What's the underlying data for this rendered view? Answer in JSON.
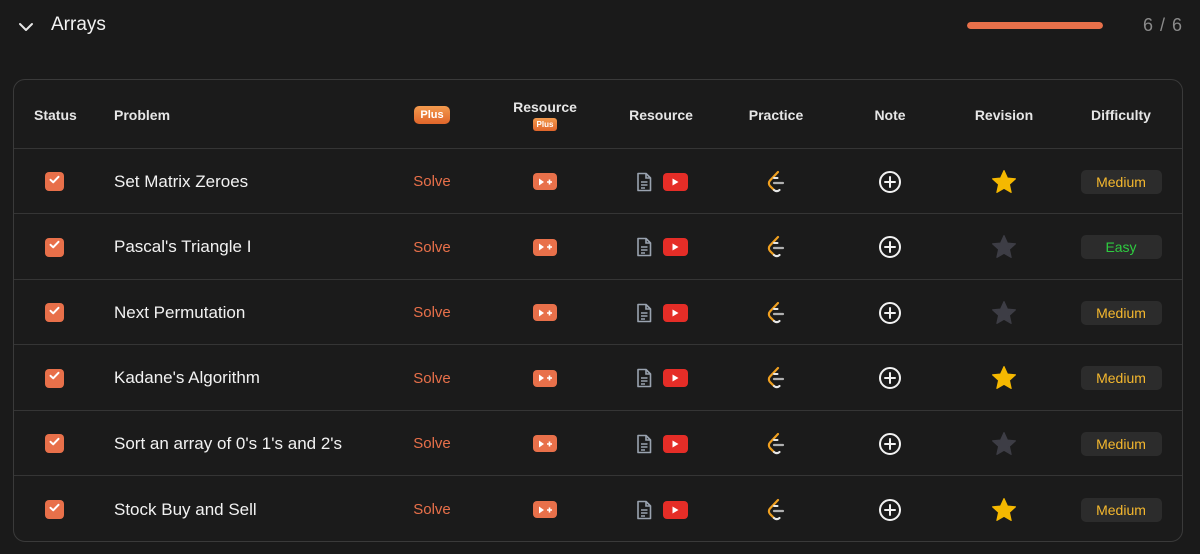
{
  "section": {
    "title": "Arrays",
    "progress_text": "6 / 6",
    "progress_fraction": 1.0,
    "accent": "#e8704a"
  },
  "table": {
    "headers": {
      "status": "Status",
      "problem": "Problem",
      "plus": "Plus",
      "resource_plus": "Resource",
      "resource_plus_badge": "Plus",
      "resource": "Resource",
      "practice": "Practice",
      "note": "Note",
      "revision": "Revision",
      "difficulty": "Difficulty"
    },
    "rows": [
      {
        "name": "Set Matrix Zeroes",
        "solve": "Solve",
        "checked": true,
        "starred": true,
        "difficulty": "Medium"
      },
      {
        "name": "Pascal's Triangle I",
        "solve": "Solve",
        "checked": true,
        "starred": false,
        "difficulty": "Easy"
      },
      {
        "name": "Next Permutation",
        "solve": "Solve",
        "checked": true,
        "starred": false,
        "difficulty": "Medium"
      },
      {
        "name": "Kadane's Algorithm",
        "solve": "Solve",
        "checked": true,
        "starred": true,
        "difficulty": "Medium"
      },
      {
        "name": "Sort an array of 0's 1's and 2's",
        "solve": "Solve",
        "checked": true,
        "starred": false,
        "difficulty": "Medium"
      },
      {
        "name": "Stock Buy and Sell",
        "solve": "Solve",
        "checked": true,
        "starred": true,
        "difficulty": "Medium"
      }
    ]
  },
  "colors": {
    "medium": "#f5b82e",
    "easy": "#2ecc40",
    "star_on": "#f5b800",
    "star_off": "#3d3d45",
    "youtube": "#e52d27"
  },
  "icons": {
    "chevron": "chevron-down-icon",
    "checkbox": "checkmark-icon",
    "video_plus": "video-plus-icon",
    "article": "document-icon",
    "youtube": "youtube-icon",
    "practice": "leetcode-icon",
    "note": "add-circle-icon",
    "revision": "star-icon"
  }
}
